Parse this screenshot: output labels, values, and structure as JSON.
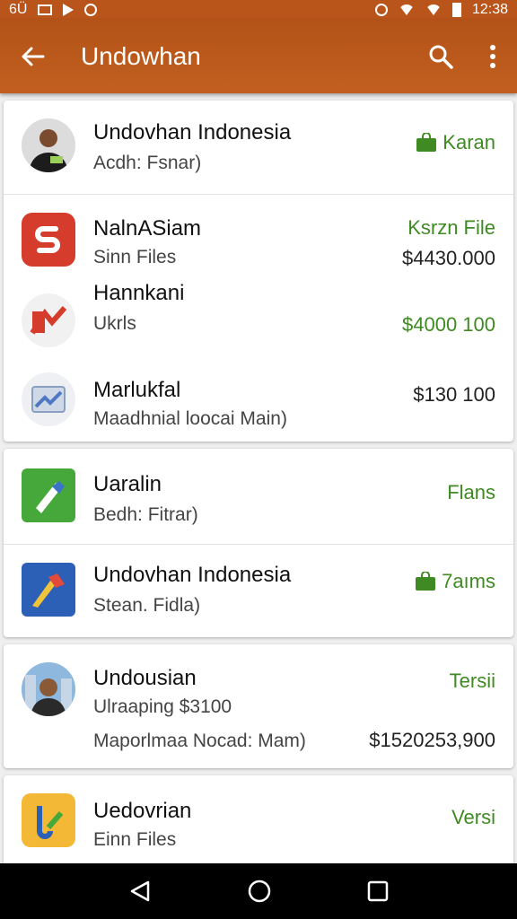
{
  "status_bar": {
    "left_text": "6Ü",
    "time": "12:38"
  },
  "app_bar": {
    "title": "Undowhan"
  },
  "colors": {
    "app_bar": "#b9541b",
    "accent_green": "#3f8a22"
  },
  "items": [
    {
      "primary": "Undovhan Indonesia",
      "secondary": "Acdh: Fsnar)",
      "meta": "Karan"
    },
    {
      "primary": "NalnASiam",
      "secondary": "Sinn Files",
      "meta": "Ksrzn File",
      "meta2": "$4430.000"
    },
    {
      "primary": "Hannkani",
      "secondary": "Ukrls",
      "meta": "$4000 100"
    },
    {
      "primary": "Marlukfal",
      "secondary": "Maadhnial loocai Main)",
      "meta": "$130 100"
    },
    {
      "primary": "Uaralin",
      "secondary": "Bedh: Fitrar)",
      "meta": "Flans"
    },
    {
      "primary": "Undovhan Indonesia",
      "secondary": "Stean. Fidla)",
      "meta": "7aıms"
    },
    {
      "primary": "Undousian",
      "secondary": "Ulraaping $3100",
      "tertiary": "Maporlmaa Nocad: Mam)",
      "meta": "Tersii",
      "meta2": "$1520253,900"
    },
    {
      "primary": "Uedovrian",
      "secondary": "Einn Files",
      "meta": "Versi"
    }
  ]
}
